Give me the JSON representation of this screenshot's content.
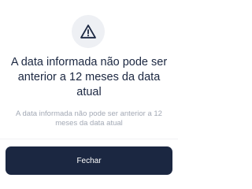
{
  "dialog": {
    "icon": "warning-triangle-icon",
    "title": "A data informada não pode ser anterior a 12 meses da data atual",
    "message": "A data informada não pode ser anterior a 12 meses da data atual",
    "close_label": "Fechar"
  },
  "colors": {
    "primary": "#1b2741",
    "muted_text": "#a3a9b5",
    "icon_background": "#eef0f4",
    "background": "#ffffff"
  }
}
